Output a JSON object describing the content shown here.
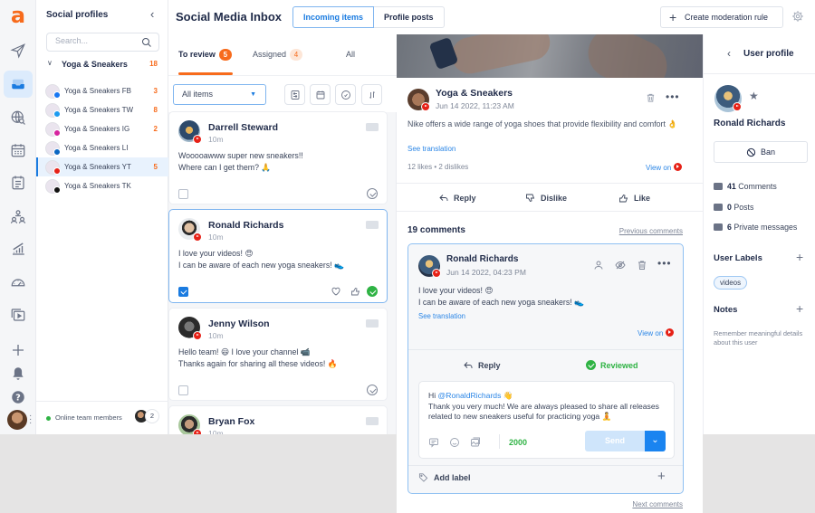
{
  "rail": {
    "logo": "a",
    "items": [
      {
        "icon": "paper-plane-icon",
        "label": "Publish"
      },
      {
        "icon": "inbox-icon",
        "label": "Inbox",
        "active": true
      },
      {
        "icon": "globe-search-icon",
        "label": "Listening"
      },
      {
        "icon": "calendar-icon",
        "label": "Calendar"
      },
      {
        "icon": "clipboard-icon",
        "label": "Tasks"
      },
      {
        "icon": "team-icon",
        "label": "Team"
      },
      {
        "icon": "analytics-icon",
        "label": "Analytics"
      },
      {
        "icon": "gauge-icon",
        "label": "Performance"
      },
      {
        "icon": "media-library-icon",
        "label": "Media"
      }
    ]
  },
  "profiles": {
    "title": "Social profiles",
    "search_placeholder": "Search...",
    "group": {
      "name": "Yoga & Sneakers",
      "count": "18"
    },
    "items": [
      {
        "name": "Yoga & Sneakers FB",
        "network": "facebook",
        "color": "#1877f2",
        "count": "3"
      },
      {
        "name": "Yoga & Sneakers TW",
        "network": "twitter",
        "color": "#1d9bf0",
        "count": "8"
      },
      {
        "name": "Yoga & Sneakers IG",
        "network": "instagram",
        "color": "#d6249f",
        "count": "2"
      },
      {
        "name": "Yoga & Sneakers LI",
        "network": "linkedin",
        "color": "#0a66c2",
        "count": ""
      },
      {
        "name": "Yoga & Sneakers YT",
        "network": "youtube",
        "color": "#e62117",
        "count": "5",
        "active": true
      },
      {
        "name": "Yoga & Sneakers TK",
        "network": "tiktok",
        "color": "#111111",
        "count": ""
      }
    ],
    "online_label": "Online team members",
    "online_count": "2"
  },
  "header": {
    "title": "Social Media Inbox",
    "tabs": [
      "Incoming items",
      "Profile posts"
    ],
    "active_tab": "Incoming items",
    "create_rule": "Create moderation rule"
  },
  "review": {
    "tabs": [
      {
        "label": "To review",
        "badge": "5",
        "active": true
      },
      {
        "label": "Assigned",
        "badge": "4"
      },
      {
        "label": "All",
        "badge": ""
      }
    ],
    "filter_value": "All items",
    "cards": [
      {
        "name": "Darrell Steward",
        "time": "10m",
        "text": "Wooooawww super new sneakers!!\nWhere can I get them? 🙏",
        "checked": false,
        "reviewed": false
      },
      {
        "name": "Ronald Richards",
        "time": "10m",
        "text": "I love your videos! 😍\nI can be aware of each new yoga sneakers! 👟",
        "checked": true,
        "reviewed": true,
        "selected": true
      },
      {
        "name": "Jenny Wilson",
        "time": "10m",
        "text": "Hello team! 😃 I love your channel 📹\nThanks again for sharing all these videos! 🔥",
        "checked": false,
        "reviewed": false
      },
      {
        "name": "Bryan Fox",
        "time": "10m",
        "text": "",
        "checked": false,
        "reviewed": false
      }
    ]
  },
  "post": {
    "author": "Yoga & Sneakers",
    "date": "Jun 14 2022, 11:23 AM",
    "text": "Nike offers a wide range of yoga shoes that provide flexibility and comfort 👌",
    "see_translation": "See translation",
    "stats": "12 likes  •  2 dislikes",
    "view_on": "View on",
    "actions": [
      "Reply",
      "Dislike",
      "Like"
    ],
    "comments_count": "19 comments",
    "previous_comments": "Previous comments",
    "next_comments": "Next comments"
  },
  "comment": {
    "author": "Ronald Richards",
    "date": "Jun 14 2022, 04:23 PM",
    "text": "I love your videos! 😍\nI can be aware of each new yoga sneakers! 👟",
    "see_translation": "See translation",
    "view_on": "View on",
    "reply_label": "Reply",
    "reviewed_label": "Reviewed",
    "reply_greeting": "Hi ",
    "reply_mention": "@RonaldRichards",
    "reply_wave": " 👋",
    "reply_body": "Thank you very much! We are always pleased to share all releases related to new sneakers useful for practicing yoga 🧘",
    "chars_left": "2000",
    "send_label": "Send",
    "add_label": "Add label"
  },
  "user": {
    "panel_title": "User profile",
    "name": "Ronald Richards",
    "ban_label": "Ban",
    "stats": [
      {
        "count": "41",
        "label": "Comments"
      },
      {
        "count": "0",
        "label": "Posts"
      },
      {
        "count": "6",
        "label": "Private messages"
      }
    ],
    "labels_title": "User Labels",
    "labels": [
      "videos"
    ],
    "notes_title": "Notes",
    "notes_hint": "Remember meaningful details about this user"
  },
  "colors": {
    "accent": "#f76b1c",
    "primary": "#1a7be0",
    "success": "#2fb344",
    "youtube": "#e62117"
  }
}
